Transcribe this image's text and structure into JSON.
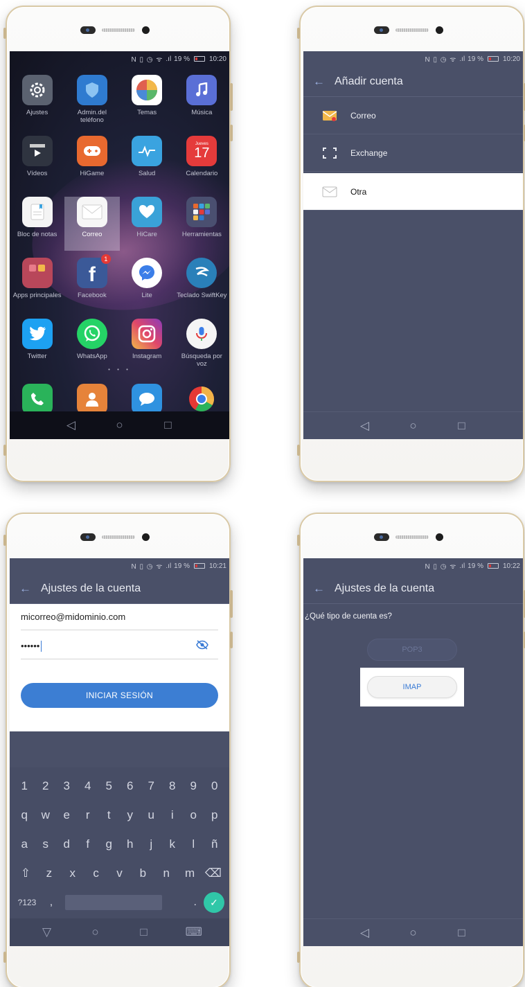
{
  "status": {
    "indicators": "N ▯ ◷ ᯤ",
    "signal": ".ıl",
    "battery": "19 %",
    "time_1": "10:20",
    "time_2": "10:20",
    "time_3": "10:21",
    "time_4": "10:22"
  },
  "home": {
    "apps": [
      {
        "label": "Ajustes",
        "icon": "settings-gear-icon",
        "color": "#5b6270"
      },
      {
        "label": "Admin.del teléfono",
        "icon": "shield-icon",
        "color": "#2f7bd0"
      },
      {
        "label": "Temas",
        "icon": "themes-icon",
        "color": "#e0604f"
      },
      {
        "label": "Música",
        "icon": "music-note-icon",
        "color": "#5a6fd6"
      },
      {
        "label": "Vídeos",
        "icon": "video-play-icon",
        "color": "#2f3440"
      },
      {
        "label": "HiGame",
        "icon": "gamepad-icon",
        "color": "#e8692f"
      },
      {
        "label": "Salud",
        "icon": "health-icon",
        "color": "#3aa3e0"
      },
      {
        "label": "Calendario",
        "icon": "calendar-icon",
        "color": "#e53b3b",
        "day_name": "Jueves",
        "day": "17"
      },
      {
        "label": "Bloc de notas",
        "icon": "notepad-icon",
        "color": "#f4f4f4"
      },
      {
        "label": "Correo",
        "icon": "mail-icon",
        "color": "#f6f6f6"
      },
      {
        "label": "HiCare",
        "icon": "hicare-heart-icon",
        "color": "#3aa2d8"
      },
      {
        "label": "Herramientas",
        "icon": "tools-folder-icon",
        "color": "#4a4f70"
      },
      {
        "label": "Apps principales",
        "icon": "apps-folder-icon",
        "color": "#b8475a"
      },
      {
        "label": "Facebook",
        "icon": "facebook-icon",
        "color": "#3b5998",
        "badge": "1"
      },
      {
        "label": "Lite",
        "icon": "messenger-icon",
        "color": "#ffffff"
      },
      {
        "label": "Teclado SwiftKey",
        "icon": "swiftkey-icon",
        "color": "#2a80b9"
      },
      {
        "label": "Twitter",
        "icon": "twitter-bird-icon",
        "color": "#1da1f2"
      },
      {
        "label": "WhatsApp",
        "icon": "whatsapp-icon",
        "color": "#25d366"
      },
      {
        "label": "Instagram",
        "icon": "instagram-icon",
        "color": "#c13584"
      },
      {
        "label": "Búsqueda por voz",
        "icon": "microphone-icon",
        "color": "#f5f5f5"
      }
    ],
    "page_dots": "• • •",
    "dock": [
      {
        "icon": "phone-icon",
        "color": "#2ab35a"
      },
      {
        "icon": "contacts-icon",
        "color": "#e6833a"
      },
      {
        "icon": "messages-icon",
        "color": "#2f92e0"
      },
      {
        "icon": "chrome-icon",
        "color": "#e2a52a"
      }
    ]
  },
  "add_account": {
    "title": "Añadir cuenta",
    "items": [
      "Correo",
      "Exchange",
      "Otra"
    ]
  },
  "account_settings": {
    "title": "Ajustes de la cuenta",
    "email_value": "micorreo@midominio.com",
    "password_value": "••••••",
    "login_button": "INICIAR SESIÓN",
    "keyboard": {
      "numbers": [
        "1",
        "2",
        "3",
        "4",
        "5",
        "6",
        "7",
        "8",
        "9",
        "0"
      ],
      "row1": [
        "q",
        "w",
        "e",
        "r",
        "t",
        "y",
        "u",
        "i",
        "o",
        "p"
      ],
      "row2": [
        "a",
        "s",
        "d",
        "f",
        "g",
        "h",
        "j",
        "k",
        "l",
        "ñ"
      ],
      "row3": [
        "⇧",
        "z",
        "x",
        "c",
        "v",
        "b",
        "n",
        "m",
        "⌫"
      ],
      "symbols_key": "?123",
      "comma_key": ",",
      "period_key": ".",
      "enter_key": "✓"
    }
  },
  "account_type": {
    "title": "Ajustes de la cuenta",
    "question": "¿Qué tipo de cuenta es?",
    "options": [
      "POP3",
      "IMAP"
    ]
  },
  "nav": {
    "back": "◁",
    "home": "○",
    "recents": "□",
    "keyboard_hide": "▽",
    "keyboard_switch": "⌨",
    "title_back": "←"
  }
}
